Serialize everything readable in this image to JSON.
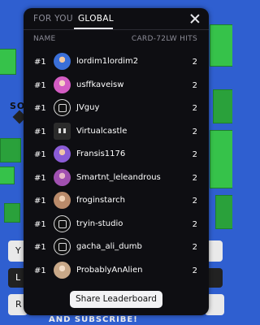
{
  "tabs": [
    {
      "label": "FOR YOU",
      "active": false
    },
    {
      "label": "GLOBAL",
      "active": true
    }
  ],
  "columns": {
    "name": "NAME",
    "hits": "CARD-72LW HITS"
  },
  "rows": [
    {
      "rank": "#1",
      "name": "lordim1lordim2",
      "hits": "2",
      "avatar": "blue-character-avatar",
      "avatar_color": "#3a6fd8"
    },
    {
      "rank": "#1",
      "name": "usffkaveisw",
      "hits": "2",
      "avatar": "pink-character-avatar",
      "avatar_color": "#d35cc3"
    },
    {
      "rank": "#1",
      "name": "JVguy",
      "hits": "2",
      "avatar": "roblox-default-avatar",
      "avatar_color": "#111111"
    },
    {
      "rank": "#1",
      "name": "Virtualcastle",
      "hits": "2",
      "avatar": "pixel-face-avatar",
      "avatar_color": "#2b2b2b"
    },
    {
      "rank": "#1",
      "name": "Fransis1176",
      "hits": "2",
      "avatar": "purple-character-avatar",
      "avatar_color": "#8b5cd6"
    },
    {
      "rank": "#1",
      "name": "Smartnt_leleandrous",
      "hits": "2",
      "avatar": "purple-pink-character-avatar",
      "avatar_color": "#a050b0"
    },
    {
      "rank": "#1",
      "name": "froginstarch",
      "hits": "2",
      "avatar": "brown-character-avatar",
      "avatar_color": "#b98a6a"
    },
    {
      "rank": "#1",
      "name": "tryin-studio",
      "hits": "2",
      "avatar": "roblox-default-avatar",
      "avatar_color": "#111111"
    },
    {
      "rank": "#1",
      "name": "gacha_ali_dumb",
      "hits": "2",
      "avatar": "roblox-default-avatar",
      "avatar_color": "#111111"
    },
    {
      "rank": "#1",
      "name": "ProbablyAnAlien",
      "hits": "2",
      "avatar": "beige-character-avatar",
      "avatar_color": "#c8a888"
    }
  ],
  "share_label": "Share Leaderboard",
  "background": {
    "left_text": "SO",
    "bottom_text": "AND SUBSCRIBE!",
    "button_letters": [
      "Y",
      "L",
      "R"
    ]
  },
  "colors": {
    "modal_bg": "#0e0e12",
    "scene_blue": "#2f5fd0",
    "scene_green": "#36c24a"
  }
}
